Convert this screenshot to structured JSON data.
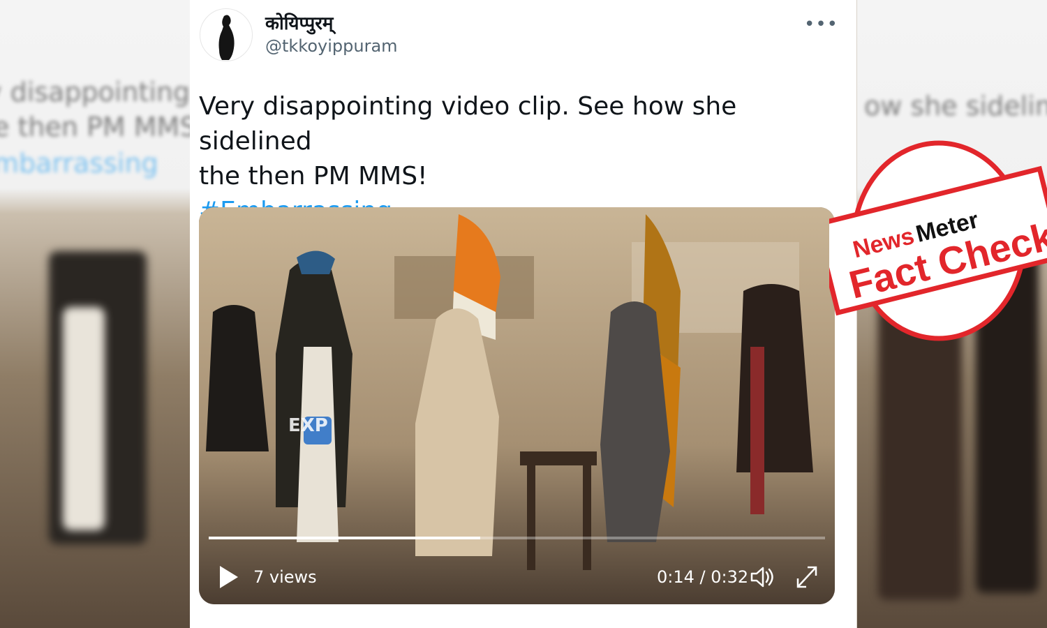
{
  "tweet": {
    "author_name": "कोयिप्पुरम्",
    "author_handle": "@tkkoyippuram",
    "more_icon": "more-horizontal-icon",
    "text_line1": "Very disappointing video clip. See how she sidelined",
    "text_line2": "the then PM MMS!",
    "hashtag": "#Embarrassing"
  },
  "video": {
    "views": "7 views",
    "current_time": "0:14",
    "duration": "0:32",
    "time_label": "0:14 / 0:32",
    "progress": 0.44,
    "watermark": "EXP",
    "icons": [
      "play-icon",
      "volume-icon",
      "fullscreen-icon"
    ]
  },
  "stamp": {
    "brand_a": "News",
    "brand_b": "Meter",
    "label": "Fact Check",
    "color": "#e2262b"
  },
  "backdrop": {
    "left_text_1": "y disappointing",
    "left_text_2": "e then PM MMS!",
    "left_text_3": "mbarrassing",
    "right_text_1": "ow she sidelined"
  },
  "colors": {
    "link": "#1d9bf0",
    "text": "#0f1419",
    "muted": "#536471"
  }
}
